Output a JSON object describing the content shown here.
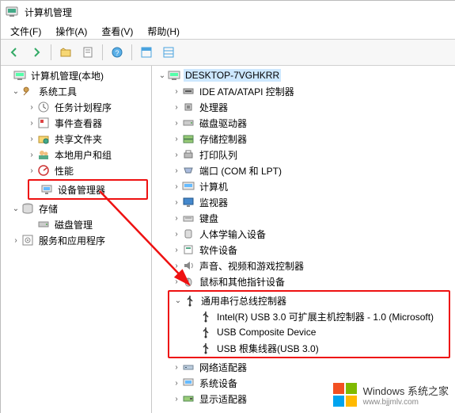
{
  "window": {
    "title": "计算机管理"
  },
  "menu": {
    "file": "文件(F)",
    "action": "操作(A)",
    "view": "查看(V)",
    "help": "帮助(H)"
  },
  "left_tree": {
    "root": "计算机管理(本地)",
    "system_tools": {
      "label": "系统工具",
      "children": {
        "task_scheduler": "任务计划程序",
        "event_viewer": "事件查看器",
        "shared_folders": "共享文件夹",
        "local_users": "本地用户和组",
        "performance": "性能",
        "device_manager": "设备管理器"
      }
    },
    "storage": {
      "label": "存储",
      "children": {
        "disk_mgmt": "磁盘管理"
      }
    },
    "services_apps": "服务和应用程序"
  },
  "right_tree": {
    "root": "DESKTOP-7VGHKRR",
    "items": {
      "ide": "IDE ATA/ATAPI 控制器",
      "cpu": "处理器",
      "disk_drives": "磁盘驱动器",
      "storage_ctrl": "存储控制器",
      "print_queues": "打印队列",
      "ports": "端口 (COM 和 LPT)",
      "computers": "计算机",
      "monitors": "监视器",
      "keyboards": "键盘",
      "hid": "人体学输入设备",
      "software_dev": "软件设备",
      "sound": "声音、视频和游戏控制器",
      "mice": "鼠标和其他指针设备",
      "usb": {
        "label": "通用串行总线控制器",
        "children": {
          "intel": "Intel(R) USB 3.0 可扩展主机控制器 - 1.0 (Microsoft)",
          "composite": "USB Composite Device",
          "root_hub": "USB 根集线器(USB 3.0)"
        }
      },
      "net": "网络适配器",
      "sys_dev": "系统设备",
      "display": "显示适配器"
    }
  },
  "watermark": {
    "brand": "Windows",
    "tagline": "系统之家",
    "url": "www.bjjmlv.com"
  }
}
